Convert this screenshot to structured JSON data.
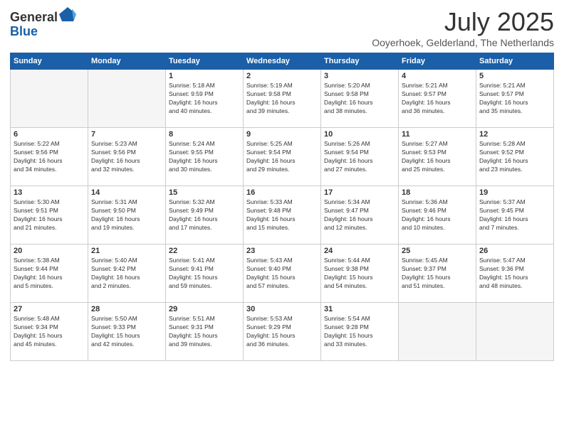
{
  "header": {
    "logo_general": "General",
    "logo_blue": "Blue",
    "main_title": "July 2025",
    "subtitle": "Ooyerhoek, Gelderland, The Netherlands"
  },
  "weekdays": [
    "Sunday",
    "Monday",
    "Tuesday",
    "Wednesday",
    "Thursday",
    "Friday",
    "Saturday"
  ],
  "weeks": [
    [
      {
        "num": "",
        "detail": ""
      },
      {
        "num": "",
        "detail": ""
      },
      {
        "num": "1",
        "detail": "Sunrise: 5:18 AM\nSunset: 9:59 PM\nDaylight: 16 hours\nand 40 minutes."
      },
      {
        "num": "2",
        "detail": "Sunrise: 5:19 AM\nSunset: 9:58 PM\nDaylight: 16 hours\nand 39 minutes."
      },
      {
        "num": "3",
        "detail": "Sunrise: 5:20 AM\nSunset: 9:58 PM\nDaylight: 16 hours\nand 38 minutes."
      },
      {
        "num": "4",
        "detail": "Sunrise: 5:21 AM\nSunset: 9:57 PM\nDaylight: 16 hours\nand 36 minutes."
      },
      {
        "num": "5",
        "detail": "Sunrise: 5:21 AM\nSunset: 9:57 PM\nDaylight: 16 hours\nand 35 minutes."
      }
    ],
    [
      {
        "num": "6",
        "detail": "Sunrise: 5:22 AM\nSunset: 9:56 PM\nDaylight: 16 hours\nand 34 minutes."
      },
      {
        "num": "7",
        "detail": "Sunrise: 5:23 AM\nSunset: 9:56 PM\nDaylight: 16 hours\nand 32 minutes."
      },
      {
        "num": "8",
        "detail": "Sunrise: 5:24 AM\nSunset: 9:55 PM\nDaylight: 16 hours\nand 30 minutes."
      },
      {
        "num": "9",
        "detail": "Sunrise: 5:25 AM\nSunset: 9:54 PM\nDaylight: 16 hours\nand 29 minutes."
      },
      {
        "num": "10",
        "detail": "Sunrise: 5:26 AM\nSunset: 9:54 PM\nDaylight: 16 hours\nand 27 minutes."
      },
      {
        "num": "11",
        "detail": "Sunrise: 5:27 AM\nSunset: 9:53 PM\nDaylight: 16 hours\nand 25 minutes."
      },
      {
        "num": "12",
        "detail": "Sunrise: 5:28 AM\nSunset: 9:52 PM\nDaylight: 16 hours\nand 23 minutes."
      }
    ],
    [
      {
        "num": "13",
        "detail": "Sunrise: 5:30 AM\nSunset: 9:51 PM\nDaylight: 16 hours\nand 21 minutes."
      },
      {
        "num": "14",
        "detail": "Sunrise: 5:31 AM\nSunset: 9:50 PM\nDaylight: 16 hours\nand 19 minutes."
      },
      {
        "num": "15",
        "detail": "Sunrise: 5:32 AM\nSunset: 9:49 PM\nDaylight: 16 hours\nand 17 minutes."
      },
      {
        "num": "16",
        "detail": "Sunrise: 5:33 AM\nSunset: 9:48 PM\nDaylight: 16 hours\nand 15 minutes."
      },
      {
        "num": "17",
        "detail": "Sunrise: 5:34 AM\nSunset: 9:47 PM\nDaylight: 16 hours\nand 12 minutes."
      },
      {
        "num": "18",
        "detail": "Sunrise: 5:36 AM\nSunset: 9:46 PM\nDaylight: 16 hours\nand 10 minutes."
      },
      {
        "num": "19",
        "detail": "Sunrise: 5:37 AM\nSunset: 9:45 PM\nDaylight: 16 hours\nand 7 minutes."
      }
    ],
    [
      {
        "num": "20",
        "detail": "Sunrise: 5:38 AM\nSunset: 9:44 PM\nDaylight: 16 hours\nand 5 minutes."
      },
      {
        "num": "21",
        "detail": "Sunrise: 5:40 AM\nSunset: 9:42 PM\nDaylight: 16 hours\nand 2 minutes."
      },
      {
        "num": "22",
        "detail": "Sunrise: 5:41 AM\nSunset: 9:41 PM\nDaylight: 15 hours\nand 59 minutes."
      },
      {
        "num": "23",
        "detail": "Sunrise: 5:43 AM\nSunset: 9:40 PM\nDaylight: 15 hours\nand 57 minutes."
      },
      {
        "num": "24",
        "detail": "Sunrise: 5:44 AM\nSunset: 9:38 PM\nDaylight: 15 hours\nand 54 minutes."
      },
      {
        "num": "25",
        "detail": "Sunrise: 5:45 AM\nSunset: 9:37 PM\nDaylight: 15 hours\nand 51 minutes."
      },
      {
        "num": "26",
        "detail": "Sunrise: 5:47 AM\nSunset: 9:36 PM\nDaylight: 15 hours\nand 48 minutes."
      }
    ],
    [
      {
        "num": "27",
        "detail": "Sunrise: 5:48 AM\nSunset: 9:34 PM\nDaylight: 15 hours\nand 45 minutes."
      },
      {
        "num": "28",
        "detail": "Sunrise: 5:50 AM\nSunset: 9:33 PM\nDaylight: 15 hours\nand 42 minutes."
      },
      {
        "num": "29",
        "detail": "Sunrise: 5:51 AM\nSunset: 9:31 PM\nDaylight: 15 hours\nand 39 minutes."
      },
      {
        "num": "30",
        "detail": "Sunrise: 5:53 AM\nSunset: 9:29 PM\nDaylight: 15 hours\nand 36 minutes."
      },
      {
        "num": "31",
        "detail": "Sunrise: 5:54 AM\nSunset: 9:28 PM\nDaylight: 15 hours\nand 33 minutes."
      },
      {
        "num": "",
        "detail": ""
      },
      {
        "num": "",
        "detail": ""
      }
    ]
  ]
}
